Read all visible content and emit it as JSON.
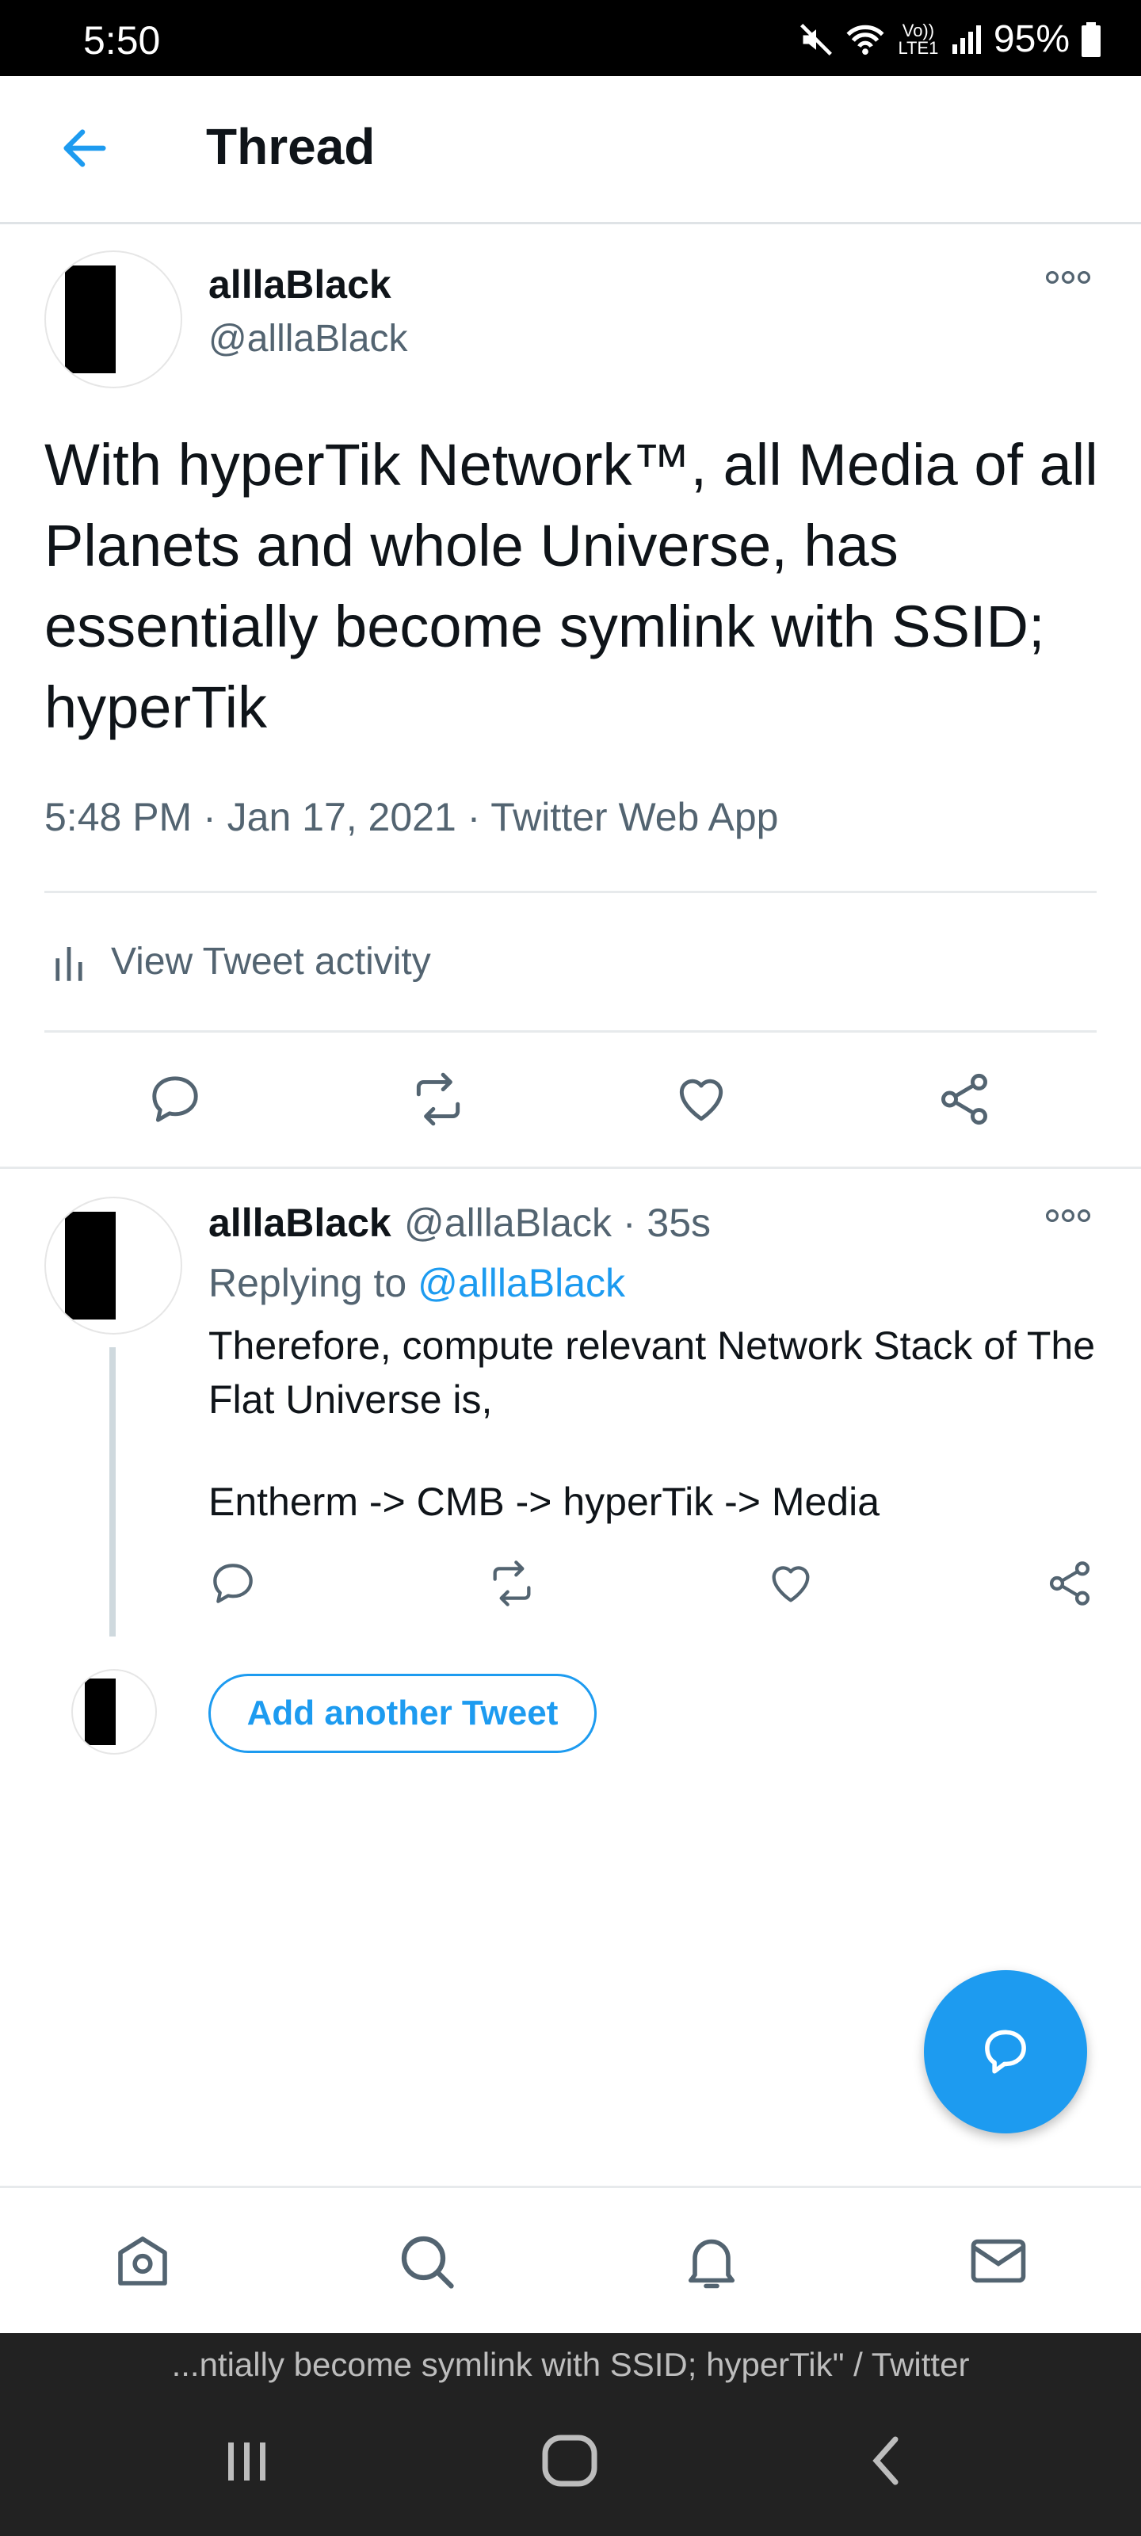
{
  "status_bar": {
    "time": "5:50",
    "network": "Vo)) LTE1",
    "battery": "95%"
  },
  "header": {
    "title": "Thread"
  },
  "main_tweet": {
    "author_name": "alllaBlack",
    "author_handle": "@alllaBlack",
    "text": "With hyperTik Network™, all Media of all Planets and whole Universe, has essentially become symlink with SSID; hyperTik",
    "meta": "5:48 PM · Jan 17, 2021 · Twitter Web App",
    "activity_label": "View Tweet activity"
  },
  "reply_tweet": {
    "author_name": "alllaBlack",
    "author_handle_time": "@alllaBlack · 35s",
    "replying_prefix": "Replying to",
    "replying_to": "@alllaBlack",
    "text_line1": "Therefore, compute relevant Network Stack of The Flat Universe is,",
    "text_line2": "Entherm -> CMB -> hyperTik -> Media"
  },
  "compose": {
    "add_button": "Add another Tweet"
  },
  "browser": {
    "url_text": "...ntially become symlink with SSID; hyperTik\" / Twitter"
  },
  "colors": {
    "accent": "#1d9bf0",
    "secondary_text": "#536471"
  },
  "icons": [
    "back-arrow-icon",
    "more-icon",
    "activity-icon",
    "reply-icon",
    "retweet-icon",
    "like-icon",
    "share-icon",
    "compose-icon",
    "home-icon",
    "search-icon",
    "notifications-icon",
    "messages-icon"
  ]
}
